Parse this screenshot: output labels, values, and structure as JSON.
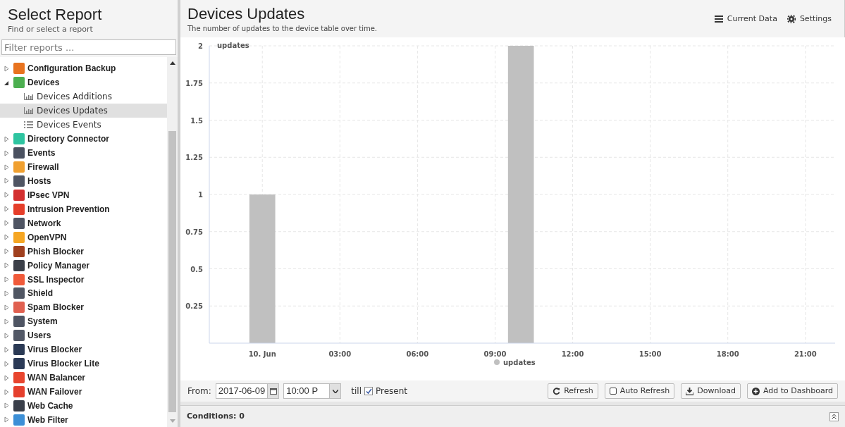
{
  "sidebar": {
    "title": "Select Report",
    "subtitle": "Find or select a report",
    "filter": {
      "placeholder": "Filter reports ..."
    },
    "items": [
      {
        "label": "Configuration Backup",
        "expanded": false,
        "color": "#e8731f"
      },
      {
        "label": "Devices",
        "expanded": true,
        "color": "#4caf50",
        "children": [
          {
            "label": "Devices Additions",
            "kind": "chart",
            "selected": false
          },
          {
            "label": "Devices Updates",
            "kind": "chart",
            "selected": true
          },
          {
            "label": "Devices Events",
            "kind": "events",
            "selected": false
          }
        ]
      },
      {
        "label": "Directory Connector",
        "expanded": false,
        "color": "#2ec4a0"
      },
      {
        "label": "Events",
        "expanded": false,
        "color": "#4a5160"
      },
      {
        "label": "Firewall",
        "expanded": false,
        "color": "#f0a030"
      },
      {
        "label": "Hosts",
        "expanded": false,
        "color": "#4f5563"
      },
      {
        "label": "IPsec VPN",
        "expanded": false,
        "color": "#d32f2f"
      },
      {
        "label": "Intrusion Prevention",
        "expanded": false,
        "color": "#e53e2a"
      },
      {
        "label": "Network",
        "expanded": false,
        "color": "#4f5563"
      },
      {
        "label": "OpenVPN",
        "expanded": false,
        "color": "#f5a623"
      },
      {
        "label": "Phish Blocker",
        "expanded": false,
        "color": "#a0401e"
      },
      {
        "label": "Policy Manager",
        "expanded": false,
        "color": "#3b3f48"
      },
      {
        "label": "SSL Inspector",
        "expanded": false,
        "color": "#f05a3a"
      },
      {
        "label": "Shield",
        "expanded": false,
        "color": "#505663"
      },
      {
        "label": "Spam Blocker",
        "expanded": false,
        "color": "#e06050"
      },
      {
        "label": "System",
        "expanded": false,
        "color": "#4f5563"
      },
      {
        "label": "Users",
        "expanded": false,
        "color": "#525866"
      },
      {
        "label": "Virus Blocker",
        "expanded": false,
        "color": "#2b3a55"
      },
      {
        "label": "Virus Blocker Lite",
        "expanded": false,
        "color": "#2b3a56"
      },
      {
        "label": "WAN Balancer",
        "expanded": false,
        "color": "#e8452e"
      },
      {
        "label": "WAN Failover",
        "expanded": false,
        "color": "#e5402d"
      },
      {
        "label": "Web Cache",
        "expanded": false,
        "color": "#3a3f4a"
      },
      {
        "label": "Web Filter",
        "expanded": false,
        "color": "#3d8fd6"
      }
    ]
  },
  "report": {
    "title": "Devices Updates",
    "description": "The number of updates to the device table over time.",
    "actions": [
      {
        "label": "Current Data",
        "kind": "list"
      },
      {
        "label": "Settings",
        "kind": "gear"
      }
    ],
    "chart_data": {
      "type": "bar",
      "x": [
        0,
        10
      ],
      "series": [
        {
          "name": "updates",
          "color": "#c0c0c0",
          "values": [
            1,
            2
          ]
        }
      ],
      "ylabel": "updates",
      "grid": true,
      "xlim": [
        -2.05,
        22.15
      ],
      "ylim": [
        0,
        2
      ],
      "yticks": [
        0.25,
        0.5,
        0.75,
        1,
        1.25,
        1.5,
        1.75,
        2
      ],
      "xticks": [
        {
          "value": 0,
          "label": "10. Jun"
        },
        {
          "value": 3,
          "label": "03:00"
        },
        {
          "value": 6,
          "label": "06:00"
        },
        {
          "value": 9,
          "label": "09:00"
        },
        {
          "value": 12,
          "label": "12:00"
        },
        {
          "value": 15,
          "label": "15:00"
        },
        {
          "value": 18,
          "label": "18:00"
        },
        {
          "value": 21,
          "label": "21:00"
        }
      ]
    }
  },
  "toolbar": {
    "from_label": "From:",
    "date": "2017-06-09",
    "time": "10:00 P",
    "till_label": "till",
    "present": {
      "label": "Present",
      "checked": true
    },
    "buttons": [
      {
        "label": "Refresh",
        "kind": "refresh"
      },
      {
        "label": "Auto Refresh",
        "kind": "toggle",
        "checked": false
      },
      {
        "label": "Download",
        "kind": "download"
      },
      {
        "label": "Add to Dashboard",
        "kind": "add"
      }
    ]
  },
  "conditions": {
    "label": "Conditions: 0"
  }
}
